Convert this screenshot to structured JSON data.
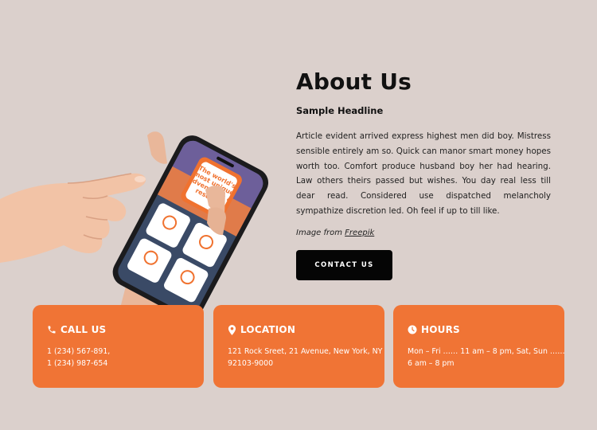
{
  "about": {
    "title": "About Us",
    "headline": "Sample Headline",
    "body": "Article evident arrived express highest men did boy. Mistress sensible entirely am so. Quick can manor smart money hopes worth too. Comfort produce husband boy her had hearing. Law others theirs passed but wishes. You day real less till dear read. Considered use dispatched melancholy sympathize discretion led. Oh feel if up to till like.",
    "credit_prefix": "Image from ",
    "credit_link": "Freepik",
    "button_label": "CONTACT US"
  },
  "hero": {
    "phone_heading": [
      "The world's",
      "most unique",
      "adventures &",
      "resorts"
    ]
  },
  "cards": [
    {
      "title": "CALL US",
      "icon": "phone-icon",
      "lines": [
        "1 (234) 567-891,",
        "1 (234) 987-654"
      ]
    },
    {
      "title": "LOCATION",
      "icon": "map-pin-icon",
      "lines": [
        "121 Rock Sreet, 21 Avenue, New York, NY",
        "92103-9000"
      ]
    },
    {
      "title": "HOURS",
      "icon": "clock-icon",
      "lines": [
        "Mon – Fri …… 11 am – 8 pm, Sat, Sun  ……",
        "6 am – 8 pm"
      ]
    }
  ],
  "colors": {
    "background": "#dbd0cc",
    "accent": "#f07435",
    "button": "#050505"
  }
}
